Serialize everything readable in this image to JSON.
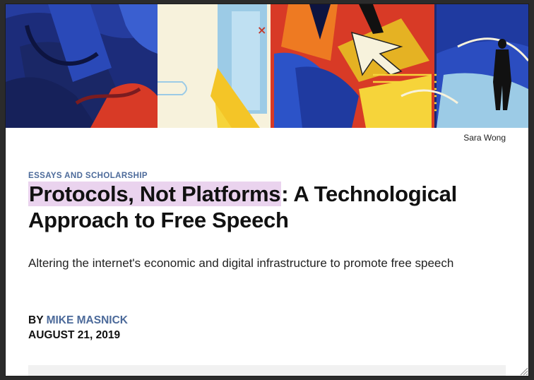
{
  "hero": {
    "credit": "Sara Wong",
    "colors": {
      "navy": "#1b2a73",
      "blue": "#2c53c8",
      "red": "#d83a26",
      "orange": "#ee7a22",
      "yellow": "#f6d43a",
      "cream": "#f7f2dc",
      "lightblue": "#9ccbe6"
    }
  },
  "article": {
    "section": "ESSAYS AND SCHOLARSHIP",
    "title_highlight": "Protocols, Not Platforms",
    "title_rest": ": A Technological Approach to Free Speech",
    "dek": "Altering the internet's economic and digital infrastructure to promote free speech",
    "by_prefix": "BY ",
    "author": "MIKE MASNICK",
    "date": "AUGUST 21, 2019"
  },
  "accent_color": "#4c6a9a",
  "highlight_color": "#ead3ee"
}
